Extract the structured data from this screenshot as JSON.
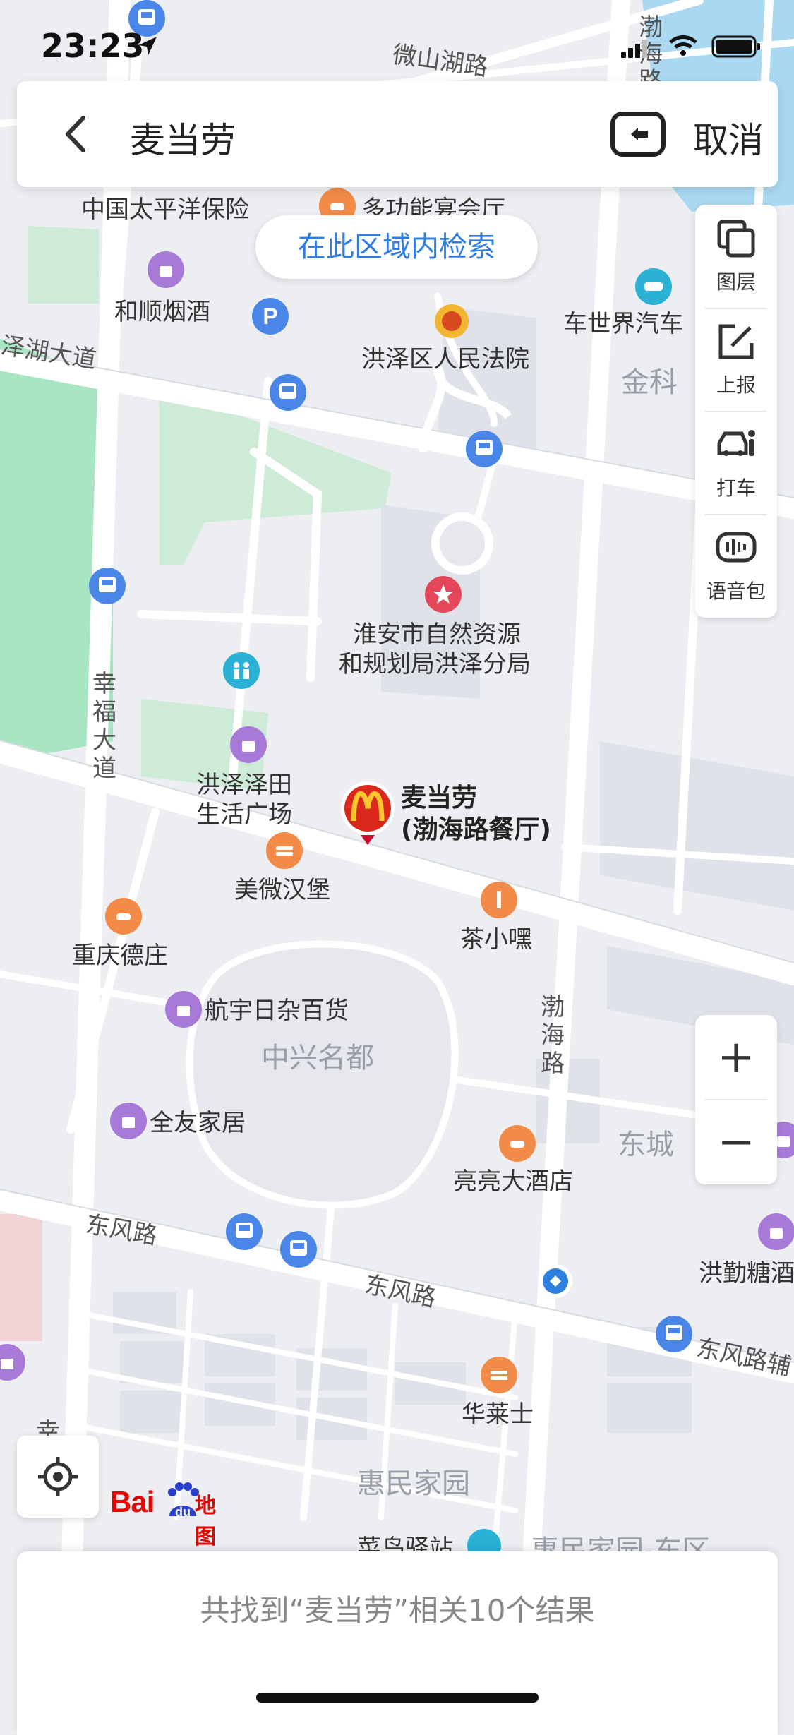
{
  "status_bar": {
    "time": "23:23"
  },
  "search_bar": {
    "query": "麦当劳",
    "cancel_label": "取消"
  },
  "area_search_label": "在此区域内检索",
  "tools": [
    {
      "label": "图层",
      "icon": "layers-icon"
    },
    {
      "label": "上报",
      "icon": "report-edit-icon"
    },
    {
      "label": "打车",
      "icon": "taxi-car-icon"
    },
    {
      "label": "语音包",
      "icon": "voice-pack-icon"
    }
  ],
  "zoom": {
    "in_label": "+",
    "out_label": "−"
  },
  "logo": {
    "bai": "Bai",
    "du": "du",
    "ditu": "地图"
  },
  "result_text": "共找到“麦当劳”相关10个结果",
  "map": {
    "roads": {
      "weishan": "微山湖路",
      "zehu": "泽湖大道",
      "xingfu": "幸福大道",
      "bohai": "渤海路",
      "bohai_top": "渤海路",
      "dongfeng_left": "东风路",
      "dongfeng_mid": "东风路",
      "dongfeng_right": "东风路辅"
    },
    "areas": {
      "zhongxing": "中兴名都",
      "jinke": "金科",
      "dongcheng": "东城",
      "huimin": "惠民家园",
      "huimin_bottom": "惠民家园-东区",
      "xing": "幸"
    },
    "pois": {
      "taipingyang": "中国太平洋保险",
      "duogongneng": "多功能宴会厅",
      "heshun": "和顺烟酒",
      "court": "洪泽区人民法院",
      "cheshijie": "车世界汽车",
      "ziran_1": "淮安市自然资源",
      "ziran_2": "和规划局洪泽分局",
      "zetian_1": "洪泽泽田",
      "zetian_2": "生活广场",
      "meiwei": "美微汉堡",
      "chongqing": "重庆德庄",
      "chaxiao": "茶小嘿",
      "hangyu": "航宇日杂百货",
      "quanyou": "全友家居",
      "liangliang": "亮亮大酒店",
      "hongqin": "洪勤糖酒",
      "hualaishi": "华莱士",
      "caishi": "菜鸟驿站"
    },
    "mcdonalds": {
      "name": "麦当劳",
      "branch": "(渤海路餐厅)"
    }
  }
}
